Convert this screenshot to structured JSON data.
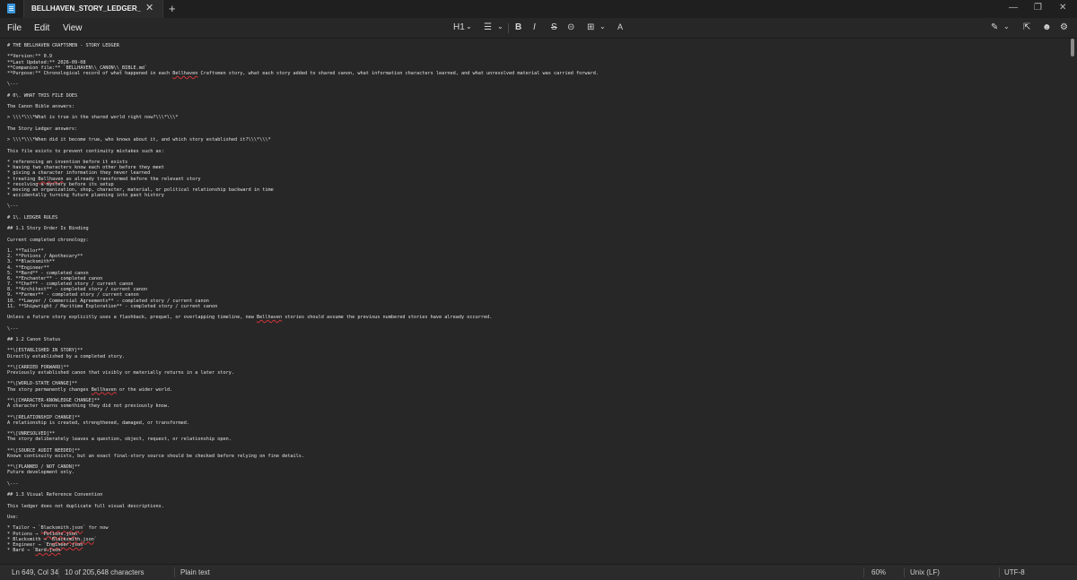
{
  "window": {
    "tab_title": "BELLHAVEN_STORY_LEDGER_UPDA",
    "close_tab_glyph": "✕",
    "new_tab_glyph": "+",
    "minimize_glyph": "—",
    "restore_glyph": "❐",
    "close_glyph": "✕"
  },
  "menu": {
    "file": "File",
    "edit": "Edit",
    "view": "View"
  },
  "toolbar": {
    "heading": "H1",
    "list_glyph": "☰",
    "bold": "B",
    "italic": "I",
    "strike": "S",
    "link_glyph": "⊝",
    "table_glyph": "⊞",
    "spellcheck_glyph": "A",
    "chevron": "⌄",
    "copilot_glyph": "✎",
    "share_glyph": "⇱",
    "account_glyph": "☻",
    "settings_glyph": "⚙"
  },
  "document": {
    "lines": [
      [
        {
          "t": "# THE BELLHAVEN CRAFTSMEN - STORY LEDGER"
        }
      ],
      [],
      [
        {
          "t": "**Version:** 0.9"
        }
      ],
      [
        {
          "t": "**Last Updated:** 2026-09-08"
        }
      ],
      [
        {
          "t": "**Companion file:** `BELLHAVEN\\\\_CANON\\\\_BIBLE.md`"
        }
      ],
      [
        {
          "t": "**Purpose:** Chronological record of what happened in each "
        },
        {
          "t": "Bellhaven",
          "sq": true
        },
        {
          "t": " Craftsmen story, what each story added to shared canon, what information characters learned, and what unresolved material was carried forward."
        }
      ],
      [],
      [
        {
          "t": "\\---"
        }
      ],
      [],
      [
        {
          "t": "# 0\\. WHAT THIS FILE DOES"
        }
      ],
      [],
      [
        {
          "t": "The Canon Bible answers:"
        }
      ],
      [],
      [
        {
          "t": "> \\\\\\*\\\\\\*What is true in the shared world right now?\\\\\\*\\\\\\*"
        }
      ],
      [],
      [
        {
          "t": "The Story Ledger answers:"
        }
      ],
      [],
      [
        {
          "t": "> \\\\\\*\\\\\\*When did it become true, who knows about it, and which story established it?\\\\\\*\\\\\\*"
        }
      ],
      [],
      [
        {
          "t": "This file exists to prevent continuity mistakes such as:"
        }
      ],
      [],
      [
        {
          "t": "* referencing an invention before it exists"
        }
      ],
      [
        {
          "t": "* having two characters know each other before they meet"
        }
      ],
      [
        {
          "t": "* giving a character information they never learned"
        }
      ],
      [
        {
          "t": "* treating "
        },
        {
          "t": "Bellhaven",
          "sq": true
        },
        {
          "t": " as already transformed before the relevant story"
        }
      ],
      [
        {
          "t": "* resolving a mystery before its setup"
        }
      ],
      [
        {
          "t": "* moving an organization, shop, character, material, or political relationship backward in time"
        }
      ],
      [
        {
          "t": "* accidentally turning future planning into past history"
        }
      ],
      [],
      [
        {
          "t": "\\---"
        }
      ],
      [],
      [
        {
          "t": "# 1\\. LEDGER RULES"
        }
      ],
      [],
      [
        {
          "t": "## 1.1 Story Order Is Binding"
        }
      ],
      [],
      [
        {
          "t": "Current completed chronology:"
        }
      ],
      [],
      [
        {
          "t": "1. **Tailor**"
        }
      ],
      [
        {
          "t": "2. **Potions / Apothecary**"
        }
      ],
      [
        {
          "t": "3. **Blacksmith**"
        }
      ],
      [
        {
          "t": "4. **Engineer**"
        }
      ],
      [
        {
          "t": "5. **Bard** - completed canon"
        }
      ],
      [
        {
          "t": "6. **Enchanter** - completed canon"
        }
      ],
      [
        {
          "t": "7. **Chef** - completed story / current canon"
        }
      ],
      [
        {
          "t": "8. **Architect** - completed story / current canon"
        }
      ],
      [
        {
          "t": "9. **Farmer** - completed story / current canon"
        }
      ],
      [
        {
          "t": "10. **Lawyer / Commercial Agreements** - completed story / current canon"
        }
      ],
      [
        {
          "t": "11. **Shipwright / Maritime Exploration** - completed story / current canon"
        }
      ],
      [],
      [
        {
          "t": "Unless a future story explicitly uses a flashback, prequel, or overlapping timeline, new "
        },
        {
          "t": "Bellhaven",
          "sq": true
        },
        {
          "t": " stories should assume the previous numbered stories have already occurred."
        }
      ],
      [],
      [
        {
          "t": "\\---"
        }
      ],
      [],
      [
        {
          "t": "## 1.2 Canon Status"
        }
      ],
      [],
      [
        {
          "t": "**\\[ESTABLISHED IN STORY]**"
        }
      ],
      [
        {
          "t": "Directly established by a completed story."
        }
      ],
      [],
      [
        {
          "t": "**\\[CARRIED FORWARD]**"
        }
      ],
      [
        {
          "t": "Previously established canon that visibly or materially returns in a later story."
        }
      ],
      [],
      [
        {
          "t": "**\\[WORLD-STATE CHANGE]**"
        }
      ],
      [
        {
          "t": "The story permanently changes "
        },
        {
          "t": "Bellhaven",
          "sq": true
        },
        {
          "t": " or the wider world."
        }
      ],
      [],
      [
        {
          "t": "**\\[CHARACTER-KNOWLEDGE CHANGE]**"
        }
      ],
      [
        {
          "t": "A character learns something they did not previously know."
        }
      ],
      [],
      [
        {
          "t": "**\\[RELATIONSHIP CHANGE]**"
        }
      ],
      [
        {
          "t": "A relationship is created, strengthened, damaged, or transformed."
        }
      ],
      [],
      [
        {
          "t": "**\\[UNRESOLVED]**"
        }
      ],
      [
        {
          "t": "The story deliberately leaves a question, object, request, or relationship open."
        }
      ],
      [],
      [
        {
          "t": "**\\[SOURCE AUDIT NEEDED]**"
        }
      ],
      [
        {
          "t": "Known continuity exists, but an exact final-story source should be checked before relying on fine details."
        }
      ],
      [],
      [
        {
          "t": "**\\[PLANNED / NOT CANON]**"
        }
      ],
      [
        {
          "t": "Future development only."
        }
      ],
      [],
      [
        {
          "t": "\\---"
        }
      ],
      [],
      [
        {
          "t": "## 1.3 Visual Reference Convention"
        }
      ],
      [],
      [
        {
          "t": "This ledger does not duplicate full visual descriptions."
        }
      ],
      [],
      [
        {
          "t": "Use:"
        }
      ],
      [],
      [
        {
          "t": "* Tailor → `"
        },
        {
          "t": "Blacksmith.json",
          "sq": true
        },
        {
          "t": "` for now"
        }
      ],
      [
        {
          "t": "* Potions → `"
        },
        {
          "t": "Potions.json",
          "sq": true
        },
        {
          "t": "`"
        }
      ],
      [
        {
          "t": "* Blacksmith → `"
        },
        {
          "t": "Blacksmith.json",
          "sq": true
        },
        {
          "t": "`"
        }
      ],
      [
        {
          "t": "* Engineer → `"
        },
        {
          "t": "Engineer.json",
          "sq": true
        },
        {
          "t": "`"
        }
      ],
      [
        {
          "t": "* Bard → `"
        },
        {
          "t": "Bard.json",
          "sq": true
        },
        {
          "t": "`"
        }
      ]
    ]
  },
  "status": {
    "position": "Ln 649, Col 34",
    "chars": "10 of 205,648 characters",
    "mode": "Plain text",
    "zoom": "60%",
    "line_endings": "Unix (LF)",
    "encoding": "UTF-8"
  }
}
